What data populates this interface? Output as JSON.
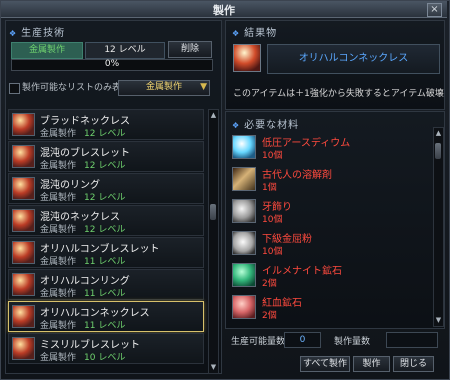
{
  "window": {
    "title": "製作",
    "close": "×"
  },
  "left": {
    "section_title": "生産技術",
    "skill_name": "金属製作",
    "skill_level": "12 レベル",
    "delete_label": "削除",
    "progress_text": "0%",
    "progress_fraction": 0,
    "checkbox_label": "製作可能なリストのみ表示",
    "filter_value": "金属製作",
    "items": [
      {
        "name": "ブラッドネックレス",
        "category": "金属製作",
        "level": "12 レベル",
        "selected": false
      },
      {
        "name": "混沌のブレスレット",
        "category": "金属製作",
        "level": "12 レベル",
        "selected": false
      },
      {
        "name": "混沌のリング",
        "category": "金属製作",
        "level": "12 レベル",
        "selected": false
      },
      {
        "name": "混沌のネックレス",
        "category": "金属製作",
        "level": "12 レベル",
        "selected": false
      },
      {
        "name": "オリハルコンブレスレット",
        "category": "金属製作",
        "level": "11 レベル",
        "selected": false
      },
      {
        "name": "オリハルコンリング",
        "category": "金属製作",
        "level": "11 レベル",
        "selected": false
      },
      {
        "name": "オリハルコンネックレス",
        "category": "金属製作",
        "level": "11 レベル",
        "selected": true
      },
      {
        "name": "ミスリルブレスレット",
        "category": "金属製作",
        "level": "10 レベル",
        "selected": false
      }
    ]
  },
  "right": {
    "result_title": "結果物",
    "result_name": "オリハルコンネックレス",
    "result_desc": "このアイテムは＋1強化から失敗するとアイテム破壊",
    "materials_title": "必要な材料",
    "materials": [
      {
        "name": "低圧アースディウム",
        "qty": "10個",
        "icon": "blue-crystal-icon"
      },
      {
        "name": "古代人の溶解剤",
        "qty": "1個",
        "icon": "bottle-icon"
      },
      {
        "name": "牙飾り",
        "qty": "10個",
        "icon": "fang-icon"
      },
      {
        "name": "下級金屈粉",
        "qty": "10個",
        "icon": "powder-icon"
      },
      {
        "name": "イルメナイト鉱石",
        "qty": "2個",
        "icon": "green-ore-icon"
      },
      {
        "name": "紅血鉱石",
        "qty": "2個",
        "icon": "red-ore-icon"
      }
    ]
  },
  "bottom": {
    "craftable_label": "生産可能量数",
    "craftable_value": "0",
    "craft_count_label": "製作量数",
    "craft_count_value": "",
    "all_button": "すべて製作",
    "craft_button": "製作",
    "close_button": "閉じる"
  },
  "colors": {
    "level_green": "#6fd16e",
    "material_red": "#ff4a3e",
    "accent_blue": "#5ea6ff"
  }
}
